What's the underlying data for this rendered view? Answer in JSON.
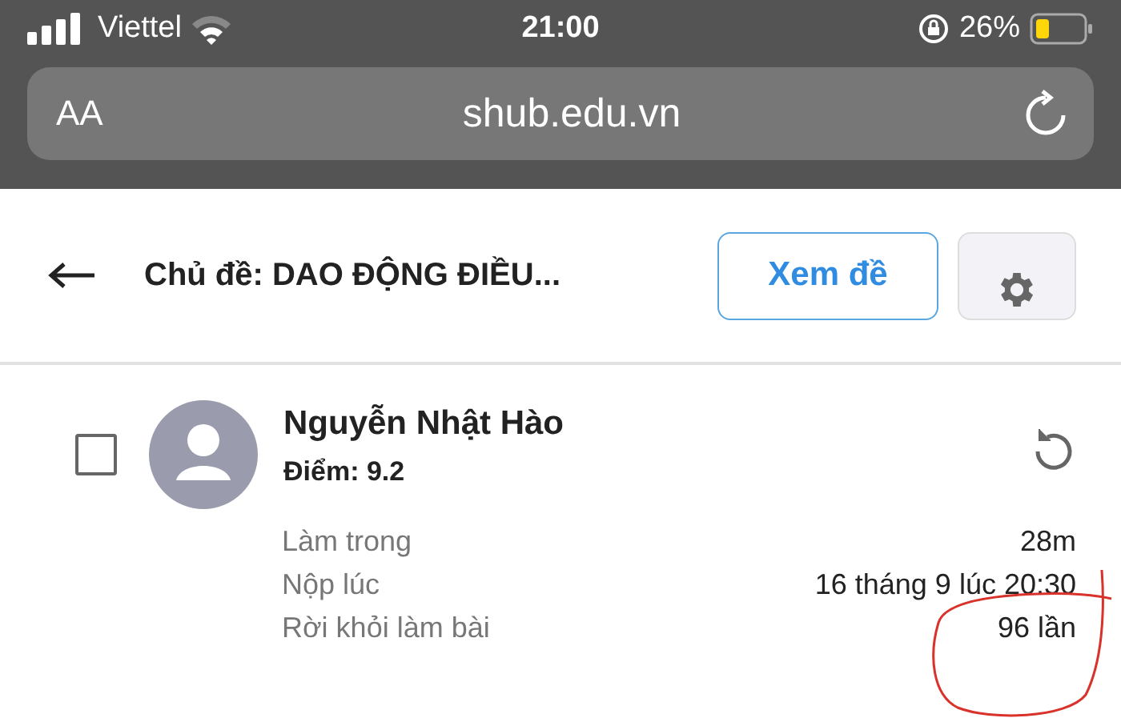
{
  "status_bar": {
    "carrier": "Viettel",
    "time": "21:00",
    "battery": "26%"
  },
  "browser": {
    "text_size": "AA",
    "url": "shub.edu.vn"
  },
  "header": {
    "title": "Chủ đề: DAO ĐỘNG ĐIỀU...",
    "view_button": "Xem đề"
  },
  "submissions": [
    {
      "checked": false,
      "name": "Nguyễn Nhật Hào",
      "score": "Điểm: 9.2",
      "details": [
        {
          "label": "Làm trong",
          "value": "28m"
        },
        {
          "label": "Nộp lúc",
          "value": "16 tháng 9 lúc 20:30"
        },
        {
          "label": "Rời khỏi làm bài",
          "value": "96 lần"
        }
      ]
    }
  ]
}
